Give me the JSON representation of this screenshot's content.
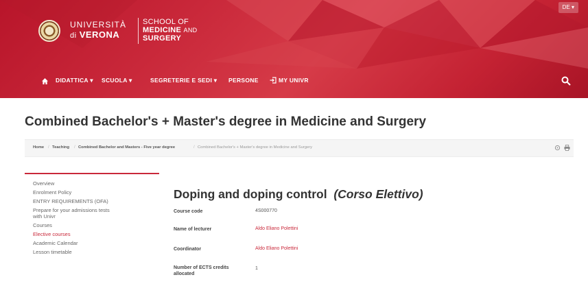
{
  "header": {
    "lang_selector": "DE ▾",
    "logo": {
      "univ_line1": "UNIVERSITÀ",
      "univ_line2_prefix": "di",
      "univ_line2_name": "VERONA",
      "school_line1": "SCHOOL OF",
      "school_line2a": "MEDICINE",
      "school_line2b": "AND",
      "school_line3": "SURGERY"
    },
    "nav": [
      "DIDATTICA ▾",
      "SCUOLA ▾",
      "SEGRETERIE E SEDI ▾",
      "PERSONE",
      "MY UNIVR"
    ],
    "colors": {
      "band": "#c9283a",
      "accent": "#c9283a"
    }
  },
  "page_title": "Combined Bachelor's + Master's degree in Medicine and Surgery",
  "breadcrumb": [
    "Home",
    "Teaching",
    "Combined Bachelor and Masters - Five year degree",
    "Combined Bachelor's + Master's degree in Medicine and Surgery"
  ],
  "sidebar": {
    "items": [
      "Overview",
      "Enrolment Policy",
      "ENTRY REQUIREMENTS (OFA)",
      "Prepare for your admissions tests",
      "with Univr",
      "Courses",
      "Elective courses",
      "Academic Calendar",
      "Lesson timetable"
    ],
    "active_index": 6
  },
  "course": {
    "title": "Doping and doping control",
    "title_suffix": "(Corso Elettivo)",
    "fields": [
      {
        "label": "Course code",
        "value": "4S000770",
        "link": false
      },
      {
        "label": "Name of lecturer",
        "value": "Aldo Eliano Polettini",
        "link": true
      },
      {
        "label": "Coordinator",
        "value": "Aldo Eliano Polettini",
        "link": true
      },
      {
        "label": "Number of ECTS credits",
        "label2": "allocated",
        "value": "1",
        "link": false
      }
    ]
  }
}
